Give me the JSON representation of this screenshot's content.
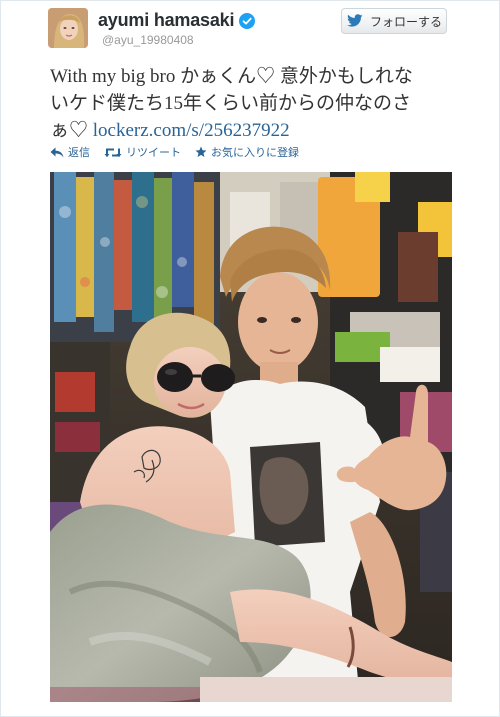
{
  "tweet": {
    "display_name": "ayumi hamasaki",
    "handle": "@ayu_19980408",
    "text_line1": "With my big bro かぁくん♡ 意外かもしれな",
    "text_line2": "いケド僕たち15年くらい前からの仲なのさ",
    "text_line3_prefix": "ぁ♡ ",
    "link": "lockerz.com/s/256237922"
  },
  "follow_button": {
    "label": "フォローする",
    "icon": "twitter-bird-icon"
  },
  "actions": {
    "reply": {
      "label": "返信",
      "icon": "reply-arrow-icon"
    },
    "retweet": {
      "label": "リツイート",
      "icon": "retweet-icon"
    },
    "favorite": {
      "label": "お気に入りに登録",
      "icon": "star-icon"
    }
  },
  "colors": {
    "link": "#2a6496",
    "verified": "#1da1f2",
    "handle": "#999999",
    "text": "#333333"
  },
  "photo": {
    "content": "photo"
  }
}
